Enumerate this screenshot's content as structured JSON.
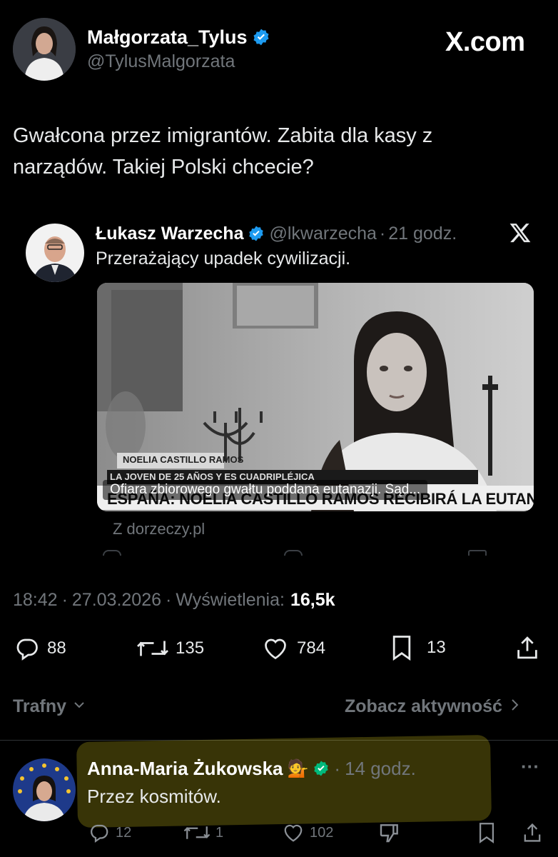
{
  "author": {
    "name": "Małgorzata_Tylus",
    "handle": "@TylusMalgorzata"
  },
  "brand": "X.com",
  "tweet_text": "Gwałcona przez imigrantów. Zabita dla kasy z narządów. Takiej Polski chcecie?",
  "quoted": {
    "name": "Łukasz Warzecha",
    "handle": "@lkwarzecha",
    "sep": "·",
    "time": "21 godz.",
    "text": "Przerażający upadek cywilizacji.",
    "media": {
      "name_tag": "NOELIA CASTILLO RAMOS",
      "lower_line": "LA JOVEN DE 25 AÑOS Y ES CUADRIPLÉJICA",
      "headline": "ESPAÑA: NOELIA CASTILLO RAMOS RECIBIRÁ LA EUTANASIA",
      "caption": "Ofiara zbiorowego gwałtu poddana eutanazji. Sąd..."
    },
    "source": "Z dorzeczy.pl"
  },
  "meta": {
    "time": "18:42",
    "sep": "·",
    "date": "27.03.2026",
    "views_label": "Wyświetlenia:",
    "views": "16,5k"
  },
  "actions": {
    "replies": "88",
    "reposts": "135",
    "likes": "784",
    "bookmarks": "13"
  },
  "sort": {
    "label": "Trafny",
    "activity": "Zobacz aktywność"
  },
  "reply": {
    "name": "Anna-Maria Żukowska",
    "emoji": "💁",
    "sep": "·",
    "time": "14 godz.",
    "text": "Przez kosmitów.",
    "more": "···",
    "replies": "12",
    "reposts": "1",
    "likes": "102"
  },
  "colors": {
    "verified": "#1d9bf0",
    "reply_verified": "#00ba7c",
    "highlight": "#f2e21f"
  }
}
